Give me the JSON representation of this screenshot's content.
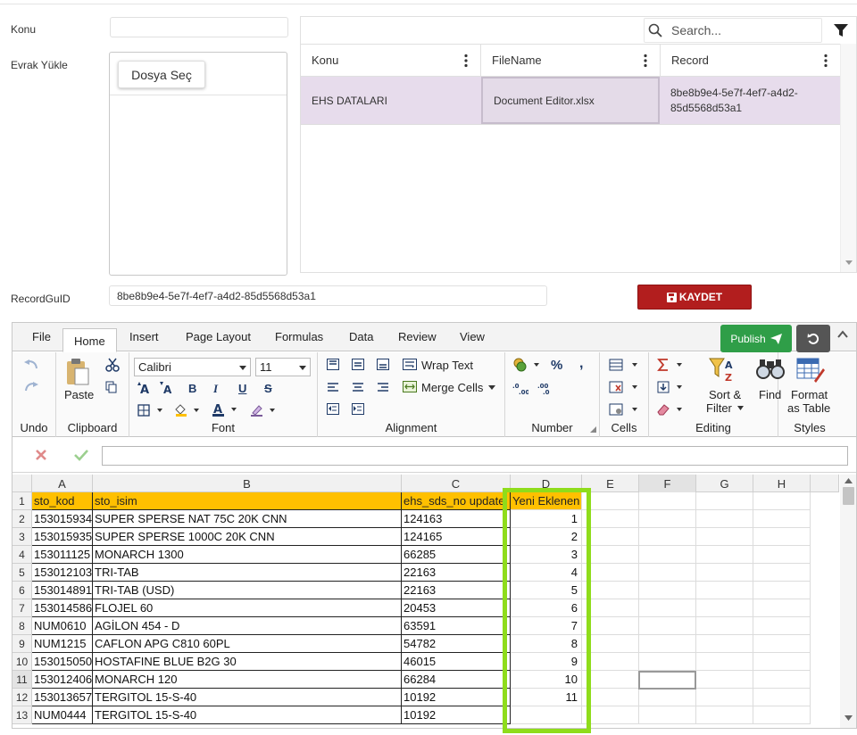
{
  "form": {
    "konu_label": "Konu",
    "konu_value": "",
    "evrak_label": "Evrak Yükle",
    "choose_file_label": "Dosya Seç",
    "recordguid_label": "RecordGuID",
    "recordguid_value": "8be8b9e4-5e7f-4ef7-a4d2-85d5568d53a1",
    "save_label": "KAYDET"
  },
  "grid": {
    "search_placeholder": "Search...",
    "columns": [
      "Konu",
      "FileName",
      "Record"
    ],
    "rows": [
      {
        "konu": "EHS DATALARI",
        "filename": "Document Editor.xlsx",
        "record_line1": "8be8b9e4-5e7f-4ef7-a4d2-",
        "record_line2": "85d5568d53a1"
      }
    ]
  },
  "spreadsheet": {
    "tabs": [
      "File",
      "Home",
      "Insert",
      "Page Layout",
      "Formulas",
      "Data",
      "Review",
      "View"
    ],
    "active_tab": "Home",
    "publish_label": "Publish",
    "ribbon": {
      "undo_group": "Undo",
      "clipboard_group": "Clipboard",
      "paste_label": "Paste",
      "font_group": "Font",
      "font_name": "Calibri",
      "font_size": "11",
      "bold": "B",
      "italic": "I",
      "underline": "U",
      "strike": "S",
      "alignment_group": "Alignment",
      "wrap_text": "Wrap Text",
      "merge_cells": "Merge Cells",
      "number_group": "Number",
      "percent": "%",
      "comma": ",",
      "cells_group": "Cells",
      "editing_group": "Editing",
      "sort_filter_1": "Sort &",
      "sort_filter_2": "Filter",
      "find_label": "Find",
      "styles_group": "Styles",
      "format_table_1": "Format",
      "format_table_2": "as Table"
    },
    "columns": [
      "A",
      "B",
      "C",
      "D",
      "E",
      "F",
      "G",
      "H"
    ],
    "selected_column": "F",
    "selected_row": "11",
    "row_numbers": [
      "1",
      "2",
      "3",
      "4",
      "5",
      "6",
      "7",
      "8",
      "9",
      "10",
      "11",
      "12",
      "13"
    ],
    "header_row": {
      "a": "sto_kod",
      "b": "sto_isim",
      "c": "ehs_sds_no update",
      "d": "Yeni Eklenen"
    },
    "data_rows": [
      {
        "a": "153015934",
        "b": "SUPER SPERSE NAT 75C 20K CNN",
        "c": "124163",
        "d": "1"
      },
      {
        "a": "153015935",
        "b": "SUPER SPERSE 1000C 20K CNN",
        "c": "124165",
        "d": "2"
      },
      {
        "a": "153011125",
        "b": "MONARCH 1300",
        "c": "66285",
        "d": "3"
      },
      {
        "a": "153012103",
        "b": "TRI-TAB",
        "c": "22163",
        "d": "4"
      },
      {
        "a": "153014891",
        "b": "TRI-TAB (USD)",
        "c": "22163",
        "d": "5"
      },
      {
        "a": "153014586",
        "b": "FLOJEL 60",
        "c": "20453",
        "d": "6"
      },
      {
        "a": "NUM0610",
        "b": "AGİLON 454 - D",
        "c": "63591",
        "d": "7"
      },
      {
        "a": "NUM1215",
        "b": "CAFLON APG C810 60PL",
        "c": "54782",
        "d": "8"
      },
      {
        "a": "153015050",
        "b": "HOSTAFINE BLUE B2G 30",
        "c": "46015",
        "d": "9"
      },
      {
        "a": "153012406",
        "b": "MONARCH 120",
        "c": "66284",
        "d": "10"
      },
      {
        "a": "153013657",
        "b": "TERGITOL 15-S-40",
        "c": "10192",
        "d": "11"
      },
      {
        "a": "NUM0444",
        "b": "TERGITOL 15-S-40",
        "c": "10192",
        "d": ""
      }
    ]
  },
  "colors": {
    "header_fill": "#ffc000",
    "highlight_box": "#8fdc1b",
    "save_button": "#b21e1e",
    "publish_button": "#2f9e48",
    "selected_row": "#e7dcec"
  }
}
